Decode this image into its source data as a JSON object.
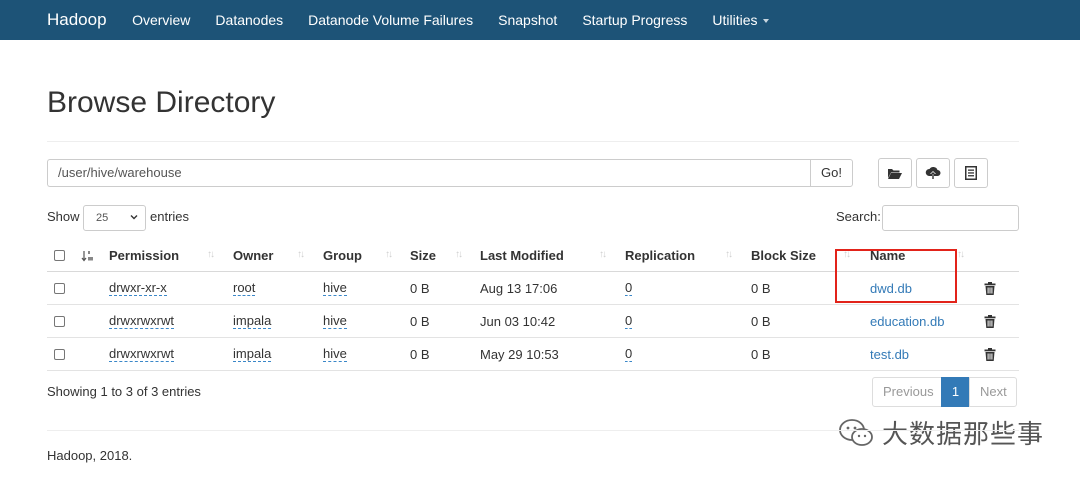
{
  "navbar": {
    "brand": "Hadoop",
    "items": [
      "Overview",
      "Datanodes",
      "Datanode Volume Failures",
      "Snapshot",
      "Startup Progress",
      "Utilities"
    ]
  },
  "page": {
    "title": "Browse Directory",
    "path": "/user/hive/warehouse",
    "go_label": "Go!"
  },
  "toolbar": {
    "buttons": [
      "folder-open-icon",
      "cloud-upload-icon",
      "list-alt-icon"
    ]
  },
  "table_controls": {
    "show_label": "Show",
    "page_size": "25",
    "entries_label": "entries",
    "search_label": "Search:",
    "search_value": ""
  },
  "table": {
    "columns": [
      "Permission",
      "Owner",
      "Group",
      "Size",
      "Last Modified",
      "Replication",
      "Block Size",
      "Name"
    ],
    "rows": [
      {
        "permission": "drwxr-xr-x",
        "owner": "root",
        "group": "hive",
        "size": "0 B",
        "modified": "Aug 13 17:06",
        "replication": "0",
        "block_size": "0 B",
        "name": "dwd.db"
      },
      {
        "permission": "drwxrwxrwt",
        "owner": "impala",
        "group": "hive",
        "size": "0 B",
        "modified": "Jun 03 10:42",
        "replication": "0",
        "block_size": "0 B",
        "name": "education.db"
      },
      {
        "permission": "drwxrwxrwt",
        "owner": "impala",
        "group": "hive",
        "size": "0 B",
        "modified": "May 29 10:53",
        "replication": "0",
        "block_size": "0 B",
        "name": "test.db"
      }
    ]
  },
  "pagination": {
    "info": "Showing 1 to 3 of 3 entries",
    "prev": "Previous",
    "current": "1",
    "next": "Next"
  },
  "footer": {
    "text": "Hadoop, 2018."
  },
  "watermark": {
    "text": "大数据那些事"
  },
  "colors": {
    "navbar": "#1d5377",
    "link": "#337ab7",
    "highlight": "#e2231a"
  }
}
